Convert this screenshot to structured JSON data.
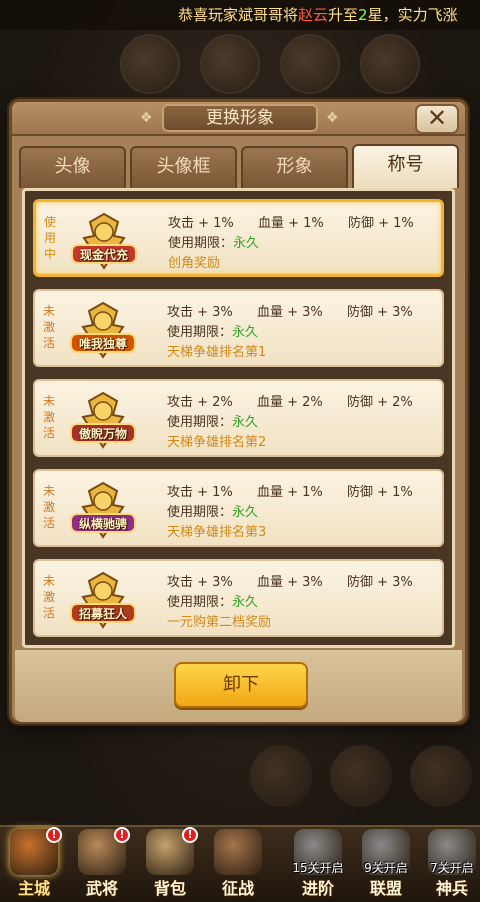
{
  "marquee": {
    "prefix": "恭喜玩家斌哥哥将",
    "hero": "赵云",
    "mid": "升至",
    "stars": "2",
    "suffix": "星，实力飞涨"
  },
  "dialog": {
    "title": "更换形象",
    "close_label": "✕",
    "tabs": [
      {
        "label": "头像",
        "active": false
      },
      {
        "label": "头像框",
        "active": false
      },
      {
        "label": "形象",
        "active": false
      },
      {
        "label": "称号",
        "active": true
      }
    ],
    "titles": [
      {
        "status": "使用中",
        "badge": "现金代充",
        "attack": "攻击 + 1%",
        "hp": "血量 + 1%",
        "defense": "防御 + 1%",
        "period_label": "使用期限：",
        "period_value": "永久",
        "source": "创角奖励",
        "selected": true,
        "badge_color": "#c0392b"
      },
      {
        "status": "未激活",
        "badge": "唯我独尊",
        "attack": "攻击 + 3%",
        "hp": "血量 + 3%",
        "defense": "防御 + 3%",
        "period_label": "使用期限：",
        "period_value": "永久",
        "source": "天梯争雄排名第1",
        "selected": false,
        "badge_color": "#d35400"
      },
      {
        "status": "未激活",
        "badge": "傲睨万物",
        "attack": "攻击 + 2%",
        "hp": "血量 + 2%",
        "defense": "防御 + 2%",
        "period_label": "使用期限：",
        "period_value": "永久",
        "source": "天梯争雄排名第2",
        "selected": false,
        "badge_color": "#a5322a"
      },
      {
        "status": "未激活",
        "badge": "纵横驰骋",
        "attack": "攻击 + 1%",
        "hp": "血量 + 1%",
        "defense": "防御 + 1%",
        "period_label": "使用期限：",
        "period_value": "永久",
        "source": "天梯争雄排名第3",
        "selected": false,
        "badge_color": "#8e2d8a"
      },
      {
        "status": "未激活",
        "badge": "招募狂人",
        "attack": "攻击 + 3%",
        "hp": "血量 + 3%",
        "defense": "防御 + 3%",
        "period_label": "使用期限：",
        "period_value": "永久",
        "source": "一元购第二档奖励",
        "selected": false,
        "badge_color": "#b03a1e"
      }
    ],
    "unequip_label": "卸下"
  },
  "nav": [
    {
      "label": "主城",
      "active": true,
      "dot": "!",
      "icon": "city-icon",
      "color": "#c9722d"
    },
    {
      "label": "武将",
      "active": false,
      "dot": "!",
      "icon": "general-icon",
      "color": "#b98a5a"
    },
    {
      "label": "背包",
      "active": false,
      "dot": "!",
      "icon": "bag-icon",
      "color": "#c6a26d"
    },
    {
      "label": "征战",
      "active": false,
      "dot": "",
      "icon": "battle-icon",
      "color": "#a5744a"
    },
    {
      "label": "进阶",
      "active": false,
      "dot": "",
      "icon": "advance-icon",
      "color": "#8a8a8a",
      "unlock": "15关开启"
    },
    {
      "label": "联盟",
      "active": false,
      "dot": "",
      "icon": "alliance-icon",
      "color": "#8a8a8a",
      "unlock": "9关开启"
    },
    {
      "label": "神兵",
      "active": false,
      "dot": "",
      "icon": "weapon-icon",
      "color": "#8a8a8a",
      "unlock": "7关开启"
    }
  ],
  "colors": {
    "accent_gold": "#f2b233",
    "green_value": "#39a02a",
    "orange_source": "#d08a1a"
  }
}
